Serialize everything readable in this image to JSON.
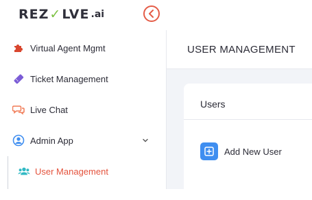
{
  "brand": {
    "logo_text_left": "REZ",
    "logo_text_mark": "✓",
    "logo_text_right": "LVE",
    "logo_text_ai": ".ai"
  },
  "header": {
    "collapse_icon": "chevron-left-circle-icon"
  },
  "sidebar": {
    "items": [
      {
        "label": "Virtual Agent Mgmt",
        "icon": "puzzle-icon",
        "icon_color": "#d9472f"
      },
      {
        "label": "Ticket Management",
        "icon": "ticket-icon",
        "icon_color": "#7b5cd6"
      },
      {
        "label": "Live Chat",
        "icon": "chat-bubbles-icon",
        "icon_color": "#f07a55"
      },
      {
        "label": "Admin App",
        "icon": "user-circle-icon",
        "icon_color": "#3f8ef0",
        "expanded": true
      },
      {
        "label": "User Management",
        "icon": "users-icon",
        "icon_color": "#31b9c4",
        "active": true
      }
    ]
  },
  "main": {
    "page_title": "USER MANAGEMENT",
    "card": {
      "title": "Users",
      "add_button_label": "Add New User"
    }
  },
  "colors": {
    "accent": "#e4533d",
    "primary": "#3f8ef0"
  }
}
